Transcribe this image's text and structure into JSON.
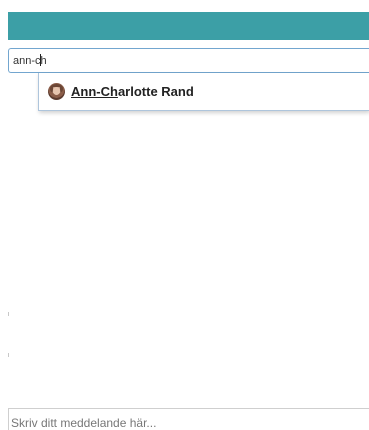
{
  "search": {
    "value": "ann-ch"
  },
  "suggestions": [
    {
      "name_match": "Ann-Ch",
      "name_rest": "arlotte Rand",
      "avatar_icon": "user-photo-icon"
    }
  ],
  "composer": {
    "placeholder": "Skriv ditt meddelande här..."
  },
  "colors": {
    "header": "#3c9fa6",
    "search_border": "#73a6cf"
  }
}
